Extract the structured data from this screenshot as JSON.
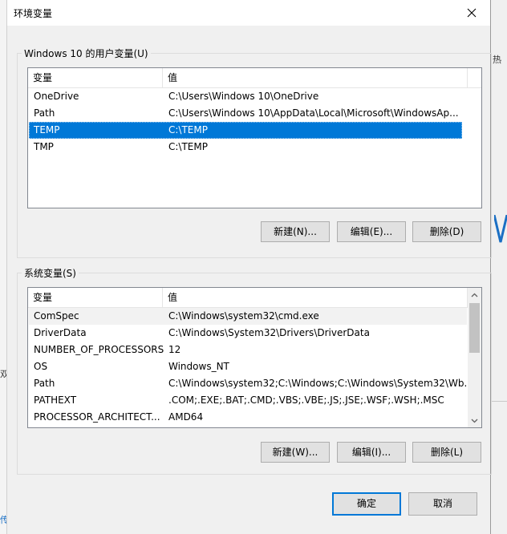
{
  "dialog": {
    "title": "环境变量",
    "close_icon": "close-icon"
  },
  "user_vars": {
    "group_label": "Windows 10 的用户变量(U)",
    "col_name": "变量",
    "col_value": "值",
    "rows": [
      {
        "name": "OneDrive",
        "value": "C:\\Users\\Windows 10\\OneDrive"
      },
      {
        "name": "Path",
        "value": "C:\\Users\\Windows 10\\AppData\\Local\\Microsoft\\WindowsAp..."
      },
      {
        "name": "TEMP",
        "value": "C:\\TEMP"
      },
      {
        "name": "TMP",
        "value": "C:\\TEMP"
      }
    ],
    "selected_row": 2,
    "btn_new": "新建(N)...",
    "btn_edit": "编辑(E)...",
    "btn_delete": "删除(D)"
  },
  "system_vars": {
    "group_label": "系统变量(S)",
    "col_name": "变量",
    "col_value": "值",
    "rows": [
      {
        "name": "ComSpec",
        "value": "C:\\Windows\\system32\\cmd.exe"
      },
      {
        "name": "DriverData",
        "value": "C:\\Windows\\System32\\Drivers\\DriverData"
      },
      {
        "name": "NUMBER_OF_PROCESSORS",
        "value": "12"
      },
      {
        "name": "OS",
        "value": "Windows_NT"
      },
      {
        "name": "Path",
        "value": "C:\\Windows\\system32;C:\\Windows;C:\\Windows\\System32\\Wb..."
      },
      {
        "name": "PATHEXT",
        "value": ".COM;.EXE;.BAT;.CMD;.VBS;.VBE;.JS;.JSE;.WSF;.WSH;.MSC"
      },
      {
        "name": "PROCESSOR_ARCHITECT...",
        "value": "AMD64"
      }
    ],
    "hot_row": 0,
    "btn_new": "新建(W)...",
    "btn_edit": "编辑(I)...",
    "btn_delete": "删除(L)"
  },
  "footer": {
    "ok": "确定",
    "cancel": "取消"
  },
  "background": {
    "right_glyph_top": "热",
    "left_glyph": "双",
    "bottom_left_glyph": "传"
  },
  "colors": {
    "selection": "#0078d7",
    "dialog_bg": "#f0f0f0",
    "default_button_border": "#0078d7"
  }
}
